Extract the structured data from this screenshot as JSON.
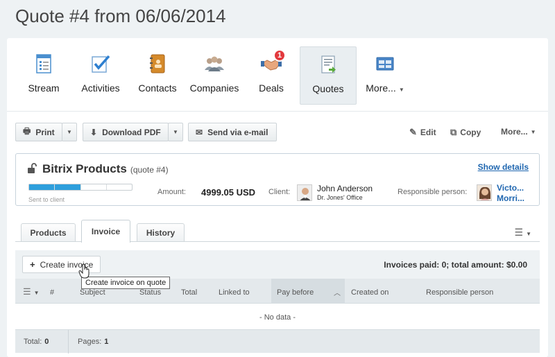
{
  "page": {
    "title": "Quote #4 from 06/06/2014"
  },
  "nav": {
    "items": [
      {
        "label": "Stream",
        "icon": "stream-icon"
      },
      {
        "label": "Activities",
        "icon": "activities-icon"
      },
      {
        "label": "Contacts",
        "icon": "contacts-icon"
      },
      {
        "label": "Companies",
        "icon": "companies-icon"
      },
      {
        "label": "Deals",
        "icon": "deals-icon",
        "badge": "1"
      },
      {
        "label": "Quotes",
        "icon": "quotes-icon",
        "active": true
      },
      {
        "label": "More...",
        "icon": "more-icon"
      }
    ]
  },
  "toolbar": {
    "print": "Print",
    "download_pdf": "Download PDF",
    "send_email": "Send via e-mail",
    "edit": "Edit",
    "copy": "Copy",
    "more": "More..."
  },
  "card": {
    "title": "Bitrix Products",
    "subtitle": "(quote #4)",
    "show_details": "Show details",
    "progress_label": "Sent to client",
    "progress_fraction": 0.5,
    "amount_label": "Amount:",
    "amount_value": "4999.05 USD",
    "client_label": "Client:",
    "client_name": "John Anderson",
    "client_company": "Dr. Jones' Office",
    "responsible_label": "Responsible person:",
    "responsible_name_1": "Victo...",
    "responsible_name_2": "Morri..."
  },
  "tabs": [
    "Products",
    "Invoice",
    "History"
  ],
  "invoice": {
    "create_button": "Create invoice",
    "summary": "Invoices paid: 0; total amount: $0.00",
    "tooltip": "Create invoice on quote",
    "columns": [
      "#",
      "Subject",
      "Status",
      "Total",
      "Linked to",
      "Pay before",
      "Created on",
      "Responsible person"
    ],
    "no_data": "- No data -",
    "footer_total_label": "Total:",
    "footer_total_value": "0",
    "footer_pages_label": "Pages:",
    "footer_pages_value": "1"
  },
  "colors": {
    "accent": "#2067b0",
    "progress": "#2e9fdc",
    "badge": "#e2393d"
  }
}
